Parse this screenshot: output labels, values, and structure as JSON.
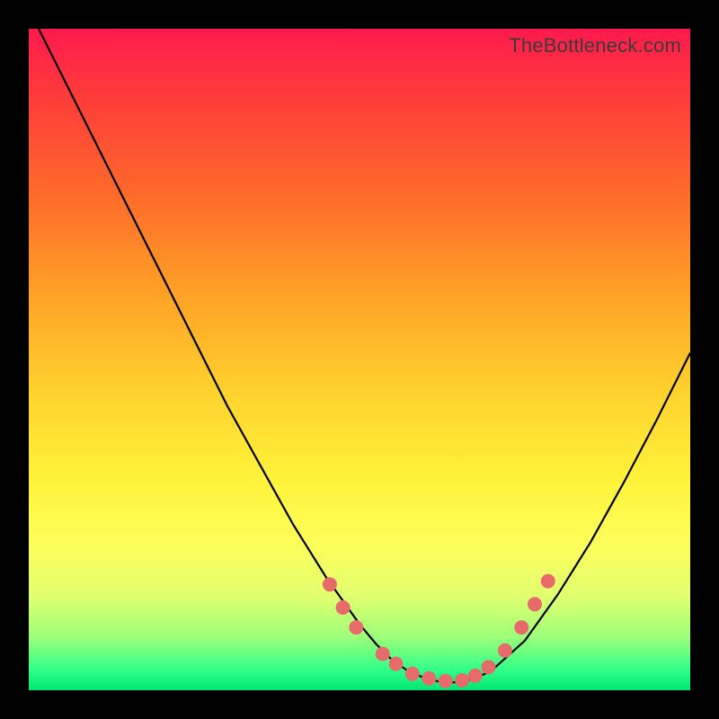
{
  "watermark": "TheBottleneck.com",
  "chart_data": {
    "type": "line",
    "title": "",
    "xlabel": "",
    "ylabel": "",
    "xlim": [
      0,
      1
    ],
    "ylim": [
      0,
      1
    ],
    "background_gradient": [
      "#ff1a4d",
      "#ff6a2a",
      "#ffd22e",
      "#fdff5a",
      "#2fff88"
    ],
    "series": [
      {
        "name": "bottleneck-curve",
        "color": "#000000",
        "x": [
          0.0,
          0.05,
          0.1,
          0.15,
          0.2,
          0.25,
          0.3,
          0.35,
          0.4,
          0.45,
          0.475,
          0.5,
          0.525,
          0.55,
          0.575,
          0.6,
          0.625,
          0.65,
          0.675,
          0.7,
          0.75,
          0.8,
          0.85,
          0.9,
          0.95,
          1.0
        ],
        "y": [
          1.03,
          0.93,
          0.83,
          0.73,
          0.63,
          0.53,
          0.43,
          0.34,
          0.25,
          0.17,
          0.135,
          0.1,
          0.07,
          0.045,
          0.028,
          0.018,
          0.012,
          0.012,
          0.018,
          0.03,
          0.075,
          0.145,
          0.225,
          0.315,
          0.41,
          0.51
        ]
      }
    ],
    "markers": {
      "name": "highlight-dots",
      "color": "#e76b6b",
      "radius": 8,
      "points": [
        {
          "x": 0.455,
          "y": 0.16
        },
        {
          "x": 0.475,
          "y": 0.125
        },
        {
          "x": 0.495,
          "y": 0.095
        },
        {
          "x": 0.535,
          "y": 0.055
        },
        {
          "x": 0.555,
          "y": 0.04
        },
        {
          "x": 0.58,
          "y": 0.025
        },
        {
          "x": 0.605,
          "y": 0.018
        },
        {
          "x": 0.63,
          "y": 0.014
        },
        {
          "x": 0.655,
          "y": 0.015
        },
        {
          "x": 0.675,
          "y": 0.022
        },
        {
          "x": 0.695,
          "y": 0.035
        },
        {
          "x": 0.72,
          "y": 0.06
        },
        {
          "x": 0.745,
          "y": 0.095
        },
        {
          "x": 0.765,
          "y": 0.13
        },
        {
          "x": 0.785,
          "y": 0.165
        }
      ]
    }
  }
}
